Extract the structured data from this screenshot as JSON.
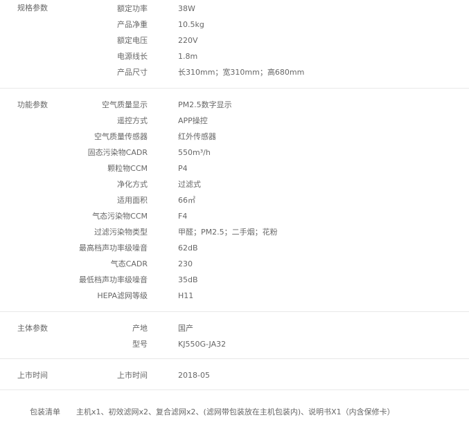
{
  "sections": [
    {
      "category": "规格参数",
      "rows": [
        {
          "label": "额定功率",
          "value": "38W"
        },
        {
          "label": "产品净重",
          "value": "10.5kg"
        },
        {
          "label": "额定电压",
          "value": "220V"
        },
        {
          "label": "电源线长",
          "value": "1.8m"
        },
        {
          "label": "产品尺寸",
          "value": "长310mm；宽310mm；高680mm"
        }
      ]
    },
    {
      "category": "功能参数",
      "rows": [
        {
          "label": "空气质量显示",
          "value": "PM2.5数字显示"
        },
        {
          "label": "遥控方式",
          "value": "APP操控"
        },
        {
          "label": "空气质量传感器",
          "value": "红外传感器"
        },
        {
          "label": "固态污染物CADR",
          "value": "550m³/h"
        },
        {
          "label": "颗粒物CCM",
          "value": "P4"
        },
        {
          "label": "净化方式",
          "value": "过滤式"
        },
        {
          "label": "适用面积",
          "value": "66㎡"
        },
        {
          "label": "气态污染物CCM",
          "value": "F4"
        },
        {
          "label": "过滤污染物类型",
          "value": "甲醛；PM2.5；二手烟；花粉"
        },
        {
          "label": "最高档声功率级噪音",
          "value": "62dB"
        },
        {
          "label": "气态CADR",
          "value": "230"
        },
        {
          "label": "最低档声功率级噪音",
          "value": "35dB"
        },
        {
          "label": "HEPA滤网等级",
          "value": "H11"
        }
      ]
    },
    {
      "category": "主体参数",
      "rows": [
        {
          "label": "产地",
          "value": "国产"
        },
        {
          "label": "型号",
          "value": "KJ550G-JA32"
        }
      ]
    },
    {
      "category": "上市时间",
      "rows": [
        {
          "label": "上市时间",
          "value": "2018-05"
        }
      ]
    }
  ],
  "package": {
    "label": "包装清单",
    "value": "主机x1、初效滤网x2、复合滤网x2、(滤网带包装放在主机包装内)、说明书X1（内含保修卡）"
  }
}
